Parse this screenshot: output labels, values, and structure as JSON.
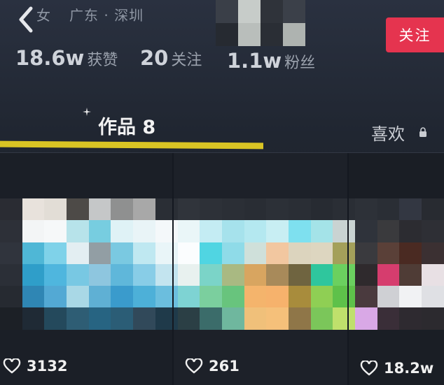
{
  "profile": {
    "gender": "女",
    "location": "广东 · 深圳",
    "follow_button": "关注",
    "stats": [
      {
        "value": "18.6w",
        "label": "获赞"
      },
      {
        "value": "20",
        "label": "关注"
      },
      {
        "value": "1.1w",
        "label": "粉丝"
      }
    ]
  },
  "tabs": {
    "works": "作品 8",
    "likes": "喜欢"
  },
  "videos": [
    {
      "likes": "3132"
    },
    {
      "likes": "261"
    },
    {
      "likes": "18.2w"
    }
  ],
  "colors": {
    "accent_red": "#e5344f",
    "tab_underline": "#d9c424"
  }
}
